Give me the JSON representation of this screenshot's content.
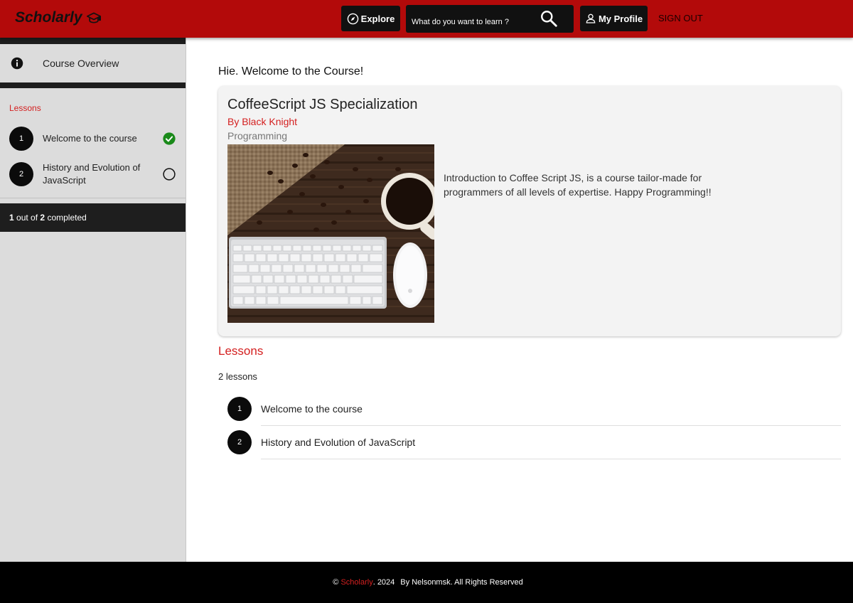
{
  "header": {
    "brand": "Scholarly",
    "brand_icon": "graduation-cap-icon",
    "explore_label": "Explore",
    "search_placeholder": "What do you want to learn ?",
    "profile_label": "My Profile",
    "signout_label": "SIGN OUT",
    "colors": {
      "background": "#b30a0a",
      "button": "#111111"
    }
  },
  "sidebar": {
    "overview_label": "Course Overview",
    "lessons_heading": "Lessons",
    "items": [
      {
        "number": "1",
        "label": "Welcome to the course",
        "completed": true
      },
      {
        "number": "2",
        "label": "History and Evolution of JavaScript",
        "completed": false
      }
    ],
    "progress": {
      "done": "1",
      "total": "2",
      "text_out_of": "out of",
      "text_completed": "completed"
    }
  },
  "main": {
    "welcome": "Hie. Welcome to the Course!",
    "course": {
      "title": "CoffeeScript JS Specialization",
      "author": "By Black Knight",
      "category": "Programming",
      "description": "Introduction to Coffee Script JS, is a course tailor-made for programmers of all levels of expertise. Happy Programming!!"
    },
    "lessons_heading": "Lessons",
    "lessons_count": "2 lessons",
    "lessons": [
      {
        "number": "1",
        "label": "Welcome to the course"
      },
      {
        "number": "2",
        "label": "History and Evolution of JavaScript"
      }
    ]
  },
  "footer": {
    "copyright": "©",
    "brand": "Scholarly",
    "year": ". 2024",
    "credit": "By Nelsonmsk. All Rights Reserved"
  },
  "colors": {
    "accent": "#d42020",
    "complete": "#1a8a1a"
  }
}
